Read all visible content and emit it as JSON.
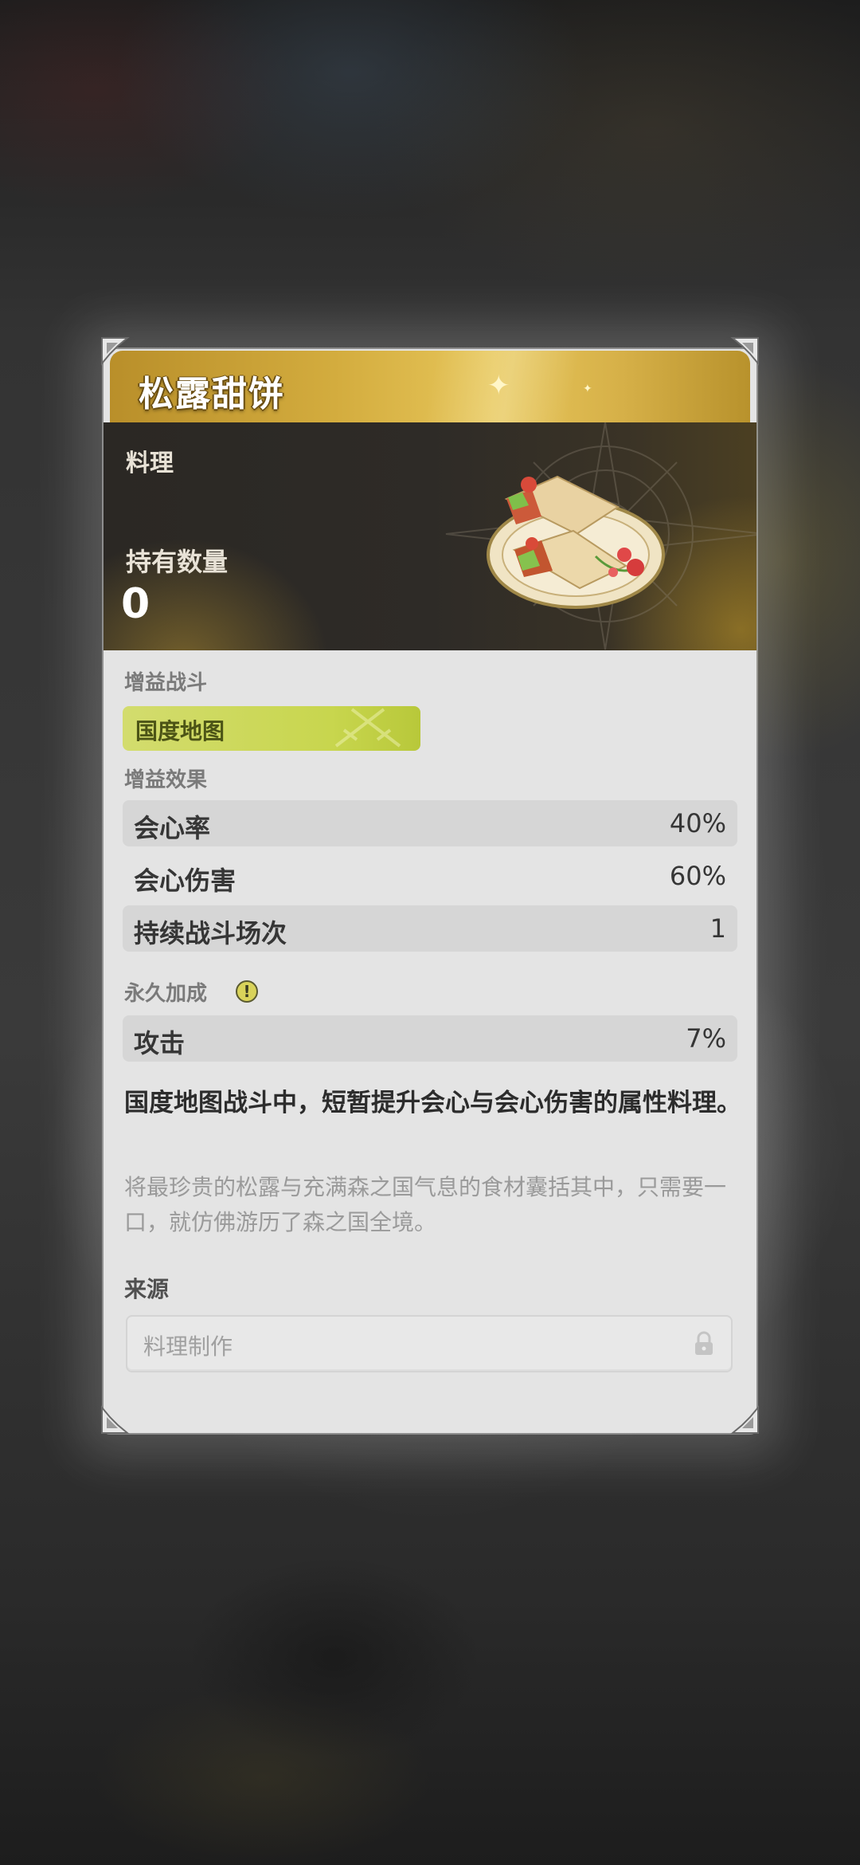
{
  "item": {
    "name": "松露甜饼",
    "category": "料理",
    "hold_label": "持有数量",
    "hold_count": "0"
  },
  "battle": {
    "label": "增益战斗",
    "type": "国度地图"
  },
  "effects": {
    "label": "增益效果",
    "rows": [
      {
        "name": "会心率",
        "value": "40%"
      },
      {
        "name": "会心伤害",
        "value": "60%"
      },
      {
        "name": "持续战斗场次",
        "value": "1"
      }
    ]
  },
  "permanent": {
    "label": "永久加成",
    "info_icon": "!",
    "rows": [
      {
        "name": "攻击",
        "value": "7%"
      }
    ]
  },
  "description": {
    "main": "国度地图战斗中，短暂提升会心与会心伤害的属性料理。",
    "flavor": "将最珍贵的松露与充满森之国气息的食材囊括其中，只需要一口，就仿佛游历了森之国全境。"
  },
  "source": {
    "label": "来源",
    "item": "料理制作"
  },
  "colors": {
    "title_gold": "#d3ac3e",
    "chip_green": "#c8d64e",
    "panel_dark": "#2b2824"
  },
  "icons": [
    "sparkle-icon",
    "info-icon",
    "lock-icon",
    "corner-ornament-icon",
    "compass-emblem-icon",
    "food-image"
  ]
}
